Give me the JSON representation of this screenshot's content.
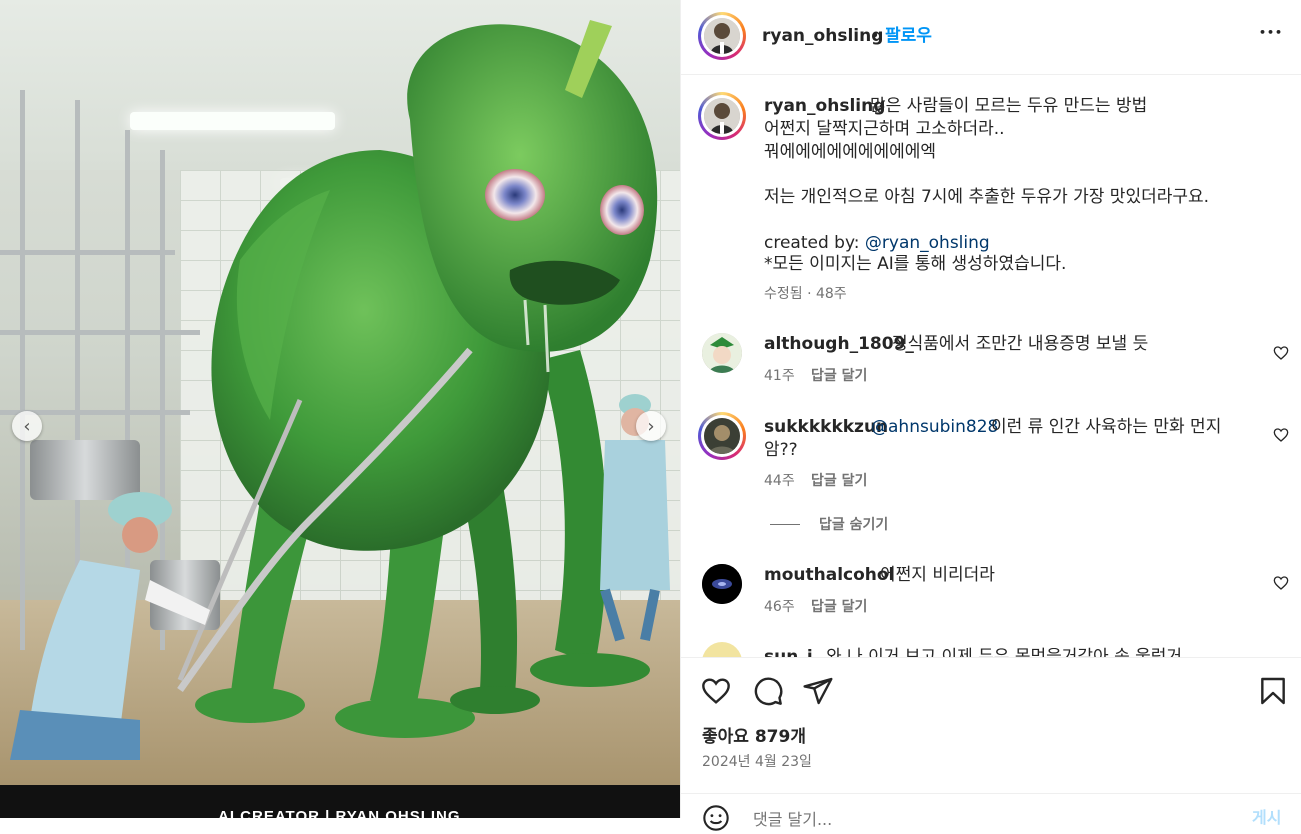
{
  "post": {
    "username": "ryan_ohsling",
    "separator": "•",
    "follow_label": "팔로우",
    "more_label": "•••"
  },
  "media": {
    "footer_text": "AI CREATOR | RYAN OHSLING",
    "prev_label": "‹",
    "next_label": "›"
  },
  "caption": {
    "username": "ryan_ohsling",
    "line1": "많은 사람들이 모르는 두유 만드는 방법",
    "line2": "어쩐지 달짝지근하며 고소하더라..",
    "line3": "꿔에에에에에에에에에엑",
    "line4": "저는 개인적으로 아침 7시에 추출한 두유가 가장 맛있더라구요.",
    "credit_prefix": "created by: ",
    "credit_mention": "@ryan_ohsling",
    "disclaimer": "*모든 이미지는 AI를 통해 생성하였습니다.",
    "meta": "수정됨 · 48주"
  },
  "comments": [
    {
      "username": "although_1809_",
      "text": "정식품에서 조만간 내용증명 보낼 듯",
      "age": "41주",
      "reply_label": "답글 달기"
    },
    {
      "username": "sukkkkkkzun",
      "mention": "@ahnsubin828",
      "text": "이런 류 인간 사육하는 만화 먼지",
      "text2": "암??",
      "age": "44주",
      "reply_label": "답글 달기",
      "hide_replies_label": "답글 숨기기"
    },
    {
      "username": "mouthalcohol",
      "text": "어쩐지 비리더라",
      "age": "46주",
      "reply_label": "답글 달기"
    },
    {
      "username": "sun_j",
      "text": "와 나 이거 보고 이제 두유 못먹을거같아 속 울렁거"
    }
  ],
  "footer": {
    "likes": "좋아요 879개",
    "date": "2024년 4월 23일",
    "comment_placeholder": "댓글 달기...",
    "post_label": "게시"
  },
  "icons": {
    "like": "heart-icon",
    "comment": "comment-icon",
    "share": "send-icon",
    "save": "bookmark-icon",
    "emoji": "emoji-icon"
  }
}
